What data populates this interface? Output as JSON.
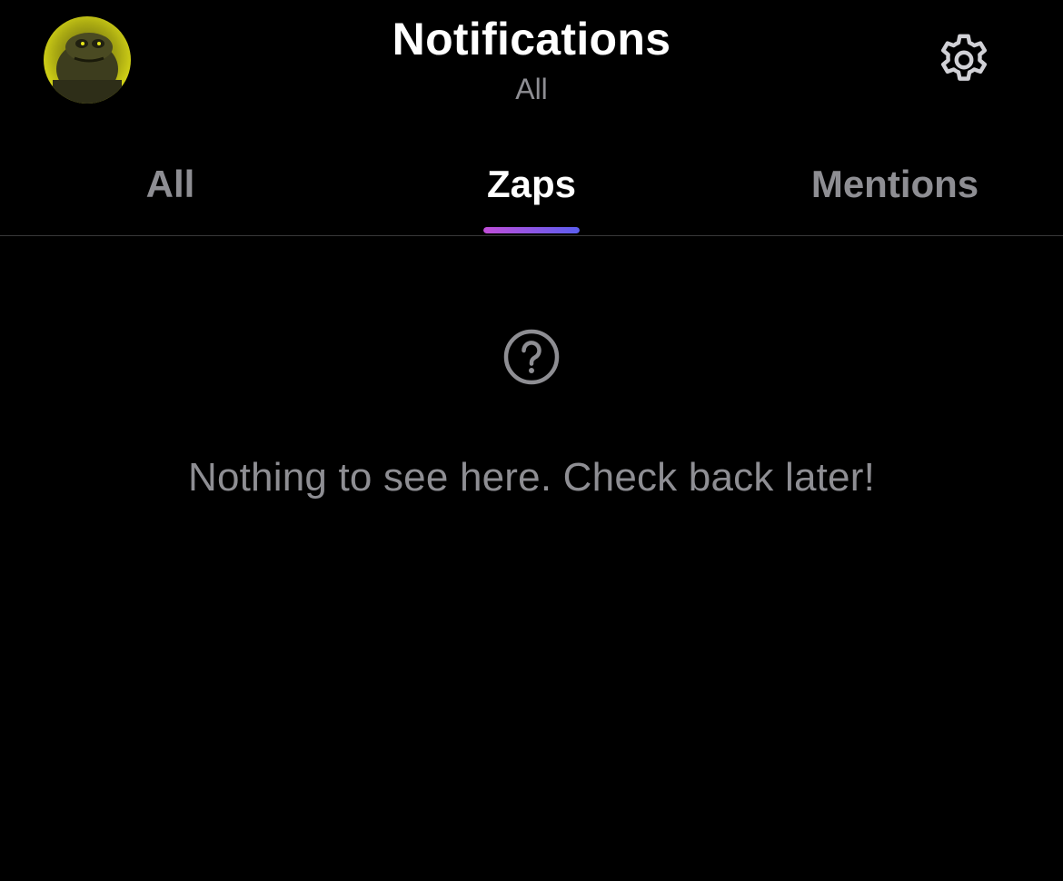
{
  "header": {
    "title": "Notifications",
    "subtitle": "All",
    "avatar_icon": "profile-avatar",
    "settings_icon": "gear-icon"
  },
  "tabs": [
    {
      "label": "All",
      "active": false
    },
    {
      "label": "Zaps",
      "active": true
    },
    {
      "label": "Mentions",
      "active": false
    }
  ],
  "empty_state": {
    "icon": "question-circle-icon",
    "message": "Nothing to see here. Check back later!"
  },
  "colors": {
    "background": "#000000",
    "primary_text": "#ffffff",
    "secondary_text": "#8e8e93",
    "divider": "#38383a",
    "indicator_start": "#c04ed8",
    "indicator_end": "#5b5ef0",
    "avatar_yellow": "#e6e619"
  }
}
